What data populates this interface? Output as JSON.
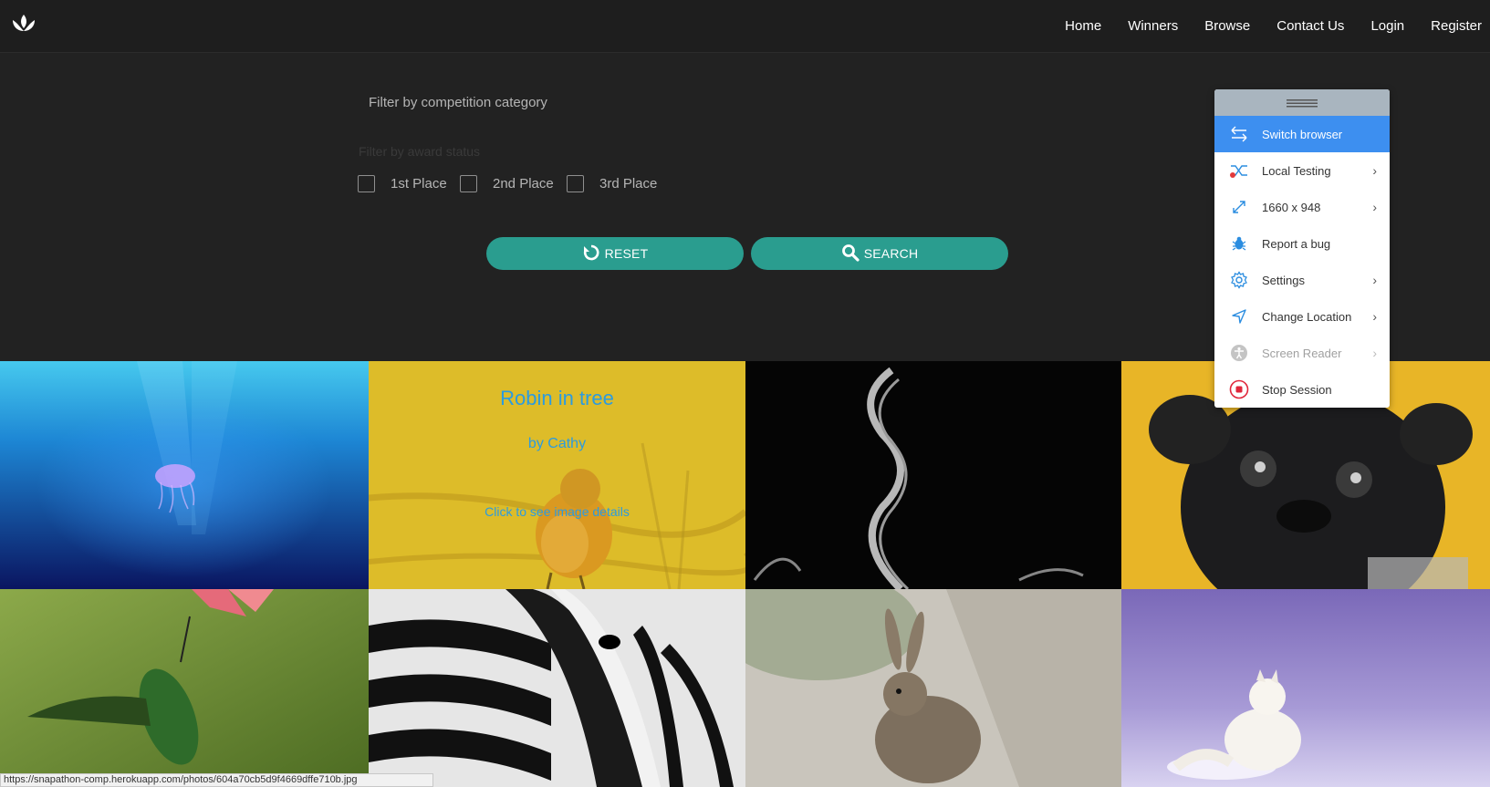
{
  "nav": {
    "links": [
      "Home",
      "Winners",
      "Browse",
      "Contact Us",
      "Login",
      "Register"
    ]
  },
  "filters": {
    "category_placeholder": "Filter by competition category",
    "award_label": "Filter by award status",
    "checkboxes": [
      "1st Place",
      "2nd Place",
      "3rd Place"
    ],
    "reset_label": "RESET",
    "search_label": "SEARCH"
  },
  "gallery": {
    "hover_tile": {
      "title": "Robin in tree",
      "author": "by Cathy",
      "cta": "Click to see image details"
    }
  },
  "panel": {
    "items": [
      {
        "label": "Switch browser",
        "icon": "switch-arrows-icon",
        "active": true,
        "chevron": false
      },
      {
        "label": "Local Testing",
        "icon": "shuffle-icon",
        "chevron": true
      },
      {
        "label": "1660 x 948",
        "icon": "resize-icon",
        "chevron": true
      },
      {
        "label": "Report a bug",
        "icon": "bug-icon",
        "chevron": false
      },
      {
        "label": "Settings",
        "icon": "gear-icon",
        "chevron": true
      },
      {
        "label": "Change Location",
        "icon": "location-arrow-icon",
        "chevron": true
      },
      {
        "label": "Screen Reader",
        "icon": "accessibility-icon",
        "chevron": true,
        "disabled": true
      },
      {
        "label": "Stop Session",
        "icon": "stop-icon",
        "chevron": false
      }
    ]
  },
  "status_bar": {
    "url": "https://snapathon-comp.herokuapp.com/photos/604a70cb5d9f4669dffe710b.jpg"
  },
  "colors": {
    "accent": "#2a9d8f",
    "panel_active": "#3d8ff0",
    "overlay_text": "#2b9be0",
    "background": "#222222"
  }
}
